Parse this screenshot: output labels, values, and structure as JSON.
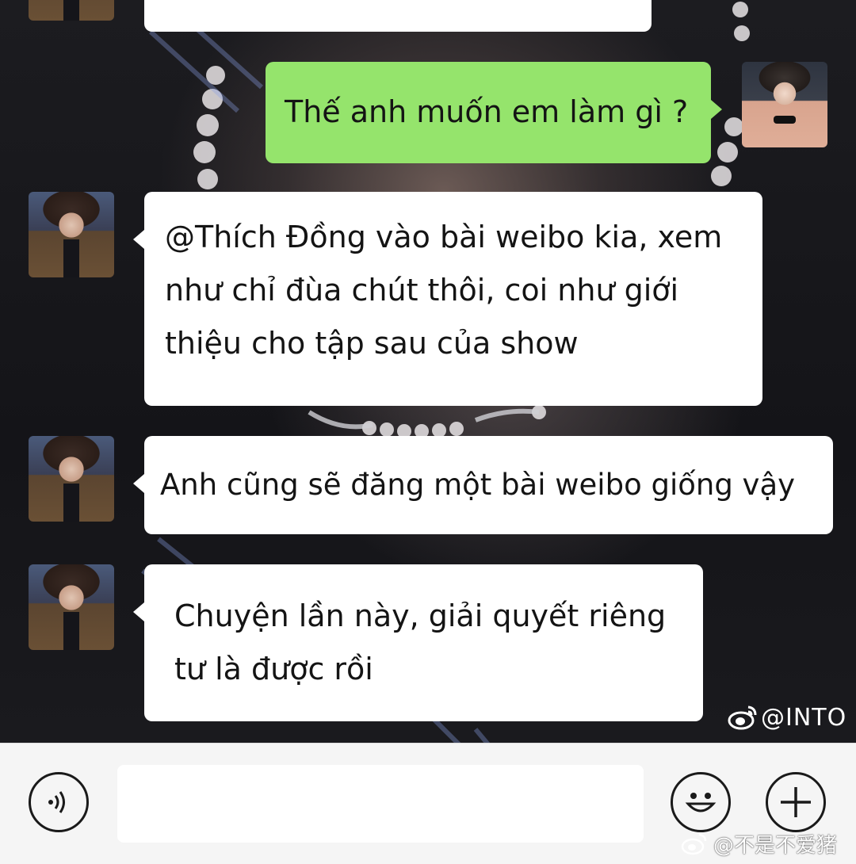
{
  "colors": {
    "incoming_bubble": "#ffffff",
    "outgoing_bubble": "#95e46c",
    "input_bar": "#f5f5f5"
  },
  "messages": [
    {
      "sender": "other",
      "text": "",
      "avatar_icon": "contact-avatar"
    },
    {
      "sender": "me",
      "text": "Thế anh muốn em làm gì ?",
      "avatar_icon": "user-avatar"
    },
    {
      "sender": "other",
      "text": "@Thích Đồng vào bài weibo kia, xem\nnhư chỉ đùa chút thôi, coi như giới\nthiệu cho tập sau của show",
      "avatar_icon": "contact-avatar"
    },
    {
      "sender": "other",
      "text": "Anh cũng sẽ đăng một bài weibo giống vậy",
      "avatar_icon": "contact-avatar"
    },
    {
      "sender": "other",
      "text": "Chuyện lần này, giải quyết riêng\ntư là được rồi",
      "avatar_icon": "contact-avatar"
    }
  ],
  "watermark": {
    "handle": "@INTO",
    "icon": "weibo-logo-icon"
  },
  "input_bar": {
    "voice_icon": "voice-icon",
    "input_value": "",
    "emoji_icon": "emoji-icon",
    "add_icon": "plus-icon"
  },
  "credit": {
    "text": "@不是不爱猪",
    "icon": "weibo-logo-icon"
  }
}
